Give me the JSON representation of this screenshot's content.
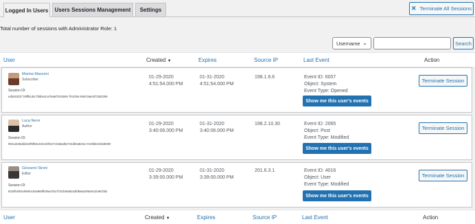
{
  "tabs": [
    {
      "label": "Logged In Users",
      "active": true
    },
    {
      "label": "Users Sessions Management",
      "active": false
    },
    {
      "label": "Settings",
      "active": false
    }
  ],
  "terminate_all": {
    "label": "Terminate All Sessions",
    "icon": "close-icon"
  },
  "summary_text": "Total number of sessions with Administrator Role: 1",
  "filter": {
    "selected": "Username",
    "search_value": "",
    "search_button": "Search"
  },
  "columns": {
    "user": "User",
    "created": "Created",
    "sort_indicator": "▼",
    "expires": "Expires",
    "source_ip": "Source IP",
    "last_event": "Last Event",
    "action": "Action"
  },
  "session_id_label": "Session ID:",
  "rows": [
    {
      "name": "Marina Mazzoni",
      "role": "Subscriber",
      "session_id": "ed5263337 b9ff81d4c7b6be0ca79a6d7619266 7fe2256 60efc0a6c873382289",
      "created_date": "01-29-2020",
      "created_time": "4:51:54.000 PM",
      "expires_date": "01-31-2020",
      "expires_time": "4:51:54.000 PM",
      "ip": "198.1.6.6",
      "event_id": "Event ID: 6007",
      "object": "Object: System",
      "event_type": "Event Type: Opened",
      "events_button": "Show me this user's events",
      "terminate_button": "Terminate Session"
    },
    {
      "name": "Luca Nervi",
      "role": "Author",
      "session_id": "994ca648ddd2e0f6f59c2e8c42f022710a9ad52744db9a8e51c7e29bb4225d6080",
      "created_date": "01-29-2020",
      "created_time": "3:40:06.000 PM",
      "expires_date": "01-31-2020",
      "expires_time": "3:40:06.000 PM",
      "ip": "198.2.10.30",
      "event_id": "Event ID: 2065",
      "object": "Object: Post",
      "event_type": "Event Type: Modified",
      "events_button": "Show me this user's events",
      "terminate_button": "Terminate Session"
    },
    {
      "name": "Giovanni Sironi",
      "role": "Editor",
      "session_id": "832dfe280cd960e193a669fb35ac001cf73d168a82a3fd8a8a295a9c32a8cf362",
      "created_date": "01-29-2020",
      "created_time": "3:39:00.000 PM",
      "expires_date": "01-31-2020",
      "expires_time": "3:39:00.000 PM",
      "ip": "201.6.3.1",
      "event_id": "Event ID: 4016",
      "object": "Object: User",
      "event_type": "Event Type: Modified",
      "events_button": "Show me this user's events",
      "terminate_button": "Terminate Session"
    }
  ]
}
